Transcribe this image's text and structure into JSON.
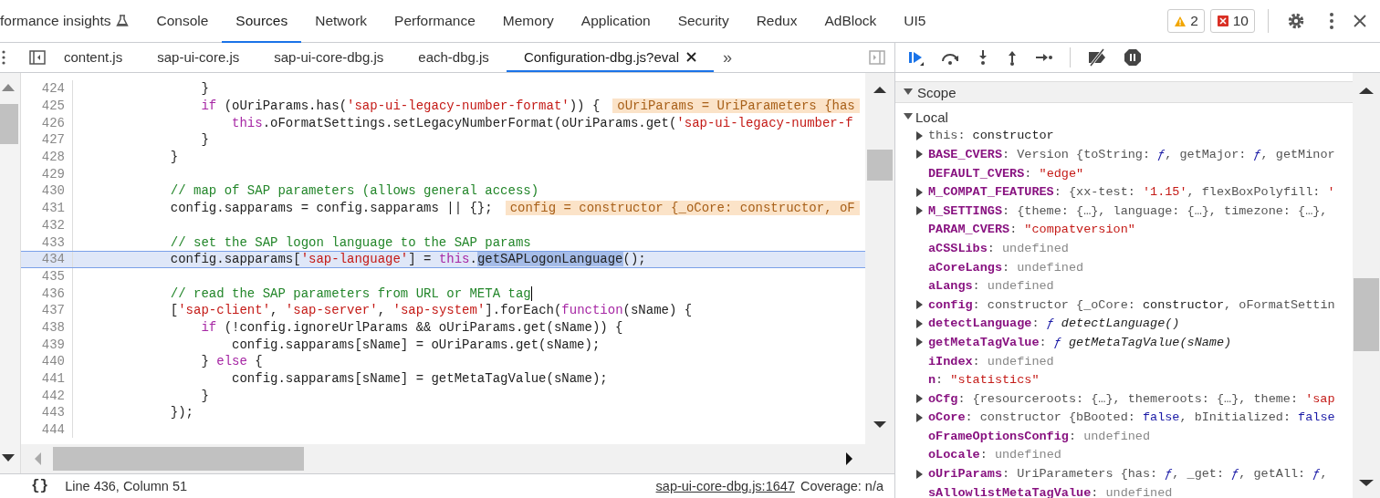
{
  "panel_tabs": [
    {
      "label": "formance insights",
      "kind": "experimental",
      "selected": false
    },
    {
      "label": "Console",
      "kind": "plain",
      "selected": false
    },
    {
      "label": "Sources",
      "kind": "plain",
      "selected": true
    },
    {
      "label": "Network",
      "kind": "plain",
      "selected": false
    },
    {
      "label": "Performance",
      "kind": "plain",
      "selected": false
    },
    {
      "label": "Memory",
      "kind": "plain",
      "selected": false
    },
    {
      "label": "Application",
      "kind": "plain",
      "selected": false
    },
    {
      "label": "Security",
      "kind": "plain",
      "selected": false
    },
    {
      "label": "Redux",
      "kind": "plain",
      "selected": false
    },
    {
      "label": "AdBlock",
      "kind": "plain",
      "selected": false
    },
    {
      "label": "UI5",
      "kind": "plain",
      "selected": false
    }
  ],
  "issue_counters": [
    {
      "kind": "warning",
      "count": "2"
    },
    {
      "kind": "error",
      "count": "10"
    }
  ],
  "file_tabs": [
    {
      "label": "content.js",
      "selected": false
    },
    {
      "label": "sap-ui-core.js",
      "selected": false
    },
    {
      "label": "sap-ui-core-dbg.js",
      "selected": false
    },
    {
      "label": "each-dbg.js",
      "selected": false
    },
    {
      "label": "Configuration-dbg.js?eval",
      "selected": true
    }
  ],
  "more_tabs": "»",
  "editor": {
    "lines": [
      {
        "number": "424",
        "tokens": [
          {
            "kind": "plain",
            "text": "                }"
          }
        ]
      },
      {
        "number": "425",
        "tokens": [
          {
            "kind": "keyword",
            "text": "                if"
          },
          {
            "kind": "plain",
            "text": " (oUriParams.has("
          },
          {
            "kind": "string",
            "text": "'sap-ui-legacy-number-format'"
          },
          {
            "kind": "plain",
            "text": ")) {"
          }
        ],
        "inline_value": "oUriParams = UriParameters {has"
      },
      {
        "number": "426",
        "tokens": [
          {
            "kind": "keyword",
            "text": "                    this"
          },
          {
            "kind": "plain",
            "text": ".oFormatSettings.setLegacyNumberFormat(oUriParams.get("
          },
          {
            "kind": "string",
            "text": "'sap-ui-legacy-number-f"
          }
        ]
      },
      {
        "number": "427",
        "tokens": [
          {
            "kind": "plain",
            "text": "                }"
          }
        ]
      },
      {
        "number": "428",
        "tokens": [
          {
            "kind": "plain",
            "text": "            }"
          }
        ]
      },
      {
        "number": "429"
      },
      {
        "number": "430",
        "tokens": [
          {
            "kind": "comment",
            "text": "            // map of SAP parameters (allows general access)"
          }
        ]
      },
      {
        "number": "431",
        "tokens": [
          {
            "kind": "plain",
            "text": "            config.sapparams = config.sapparams || {};"
          }
        ],
        "inline_value": "config = constructor {_oCore: constructor, oF"
      },
      {
        "number": "432"
      },
      {
        "number": "433",
        "tokens": [
          {
            "kind": "comment",
            "text": "            // set the SAP logon language to the SAP params"
          }
        ]
      },
      {
        "number": "434",
        "highlighted": true,
        "tokens": [
          {
            "kind": "plain",
            "text": "            config.sapparams["
          },
          {
            "kind": "string",
            "text": "'sap-language'"
          },
          {
            "kind": "plain",
            "text": "] = "
          },
          {
            "kind": "keyword",
            "text": "this"
          },
          {
            "kind": "plain",
            "text": "."
          },
          {
            "kind": "selection",
            "text": "getSAPLogonLanguage"
          },
          {
            "kind": "plain",
            "text": "();"
          }
        ]
      },
      {
        "number": "435"
      },
      {
        "number": "436",
        "cursor": true,
        "tokens": [
          {
            "kind": "comment",
            "text": "            // read the SAP parameters from URL or META tag"
          }
        ]
      },
      {
        "number": "437",
        "tokens": [
          {
            "kind": "plain",
            "text": "            ["
          },
          {
            "kind": "string",
            "text": "'sap-client'"
          },
          {
            "kind": "plain",
            "text": ", "
          },
          {
            "kind": "string",
            "text": "'sap-server'"
          },
          {
            "kind": "plain",
            "text": ", "
          },
          {
            "kind": "string",
            "text": "'sap-system'"
          },
          {
            "kind": "plain",
            "text": "].forEach("
          },
          {
            "kind": "keyword",
            "text": "function"
          },
          {
            "kind": "plain",
            "text": "(sName) {"
          }
        ]
      },
      {
        "number": "438",
        "tokens": [
          {
            "kind": "keyword",
            "text": "                if"
          },
          {
            "kind": "plain",
            "text": " (!config.ignoreUrlParams && oUriParams.get(sName)) {"
          }
        ]
      },
      {
        "number": "439",
        "tokens": [
          {
            "kind": "plain",
            "text": "                    config.sapparams[sName] = oUriParams.get(sName);"
          }
        ]
      },
      {
        "number": "440",
        "tokens": [
          {
            "kind": "plain",
            "text": "                } "
          },
          {
            "kind": "keyword",
            "text": "else"
          },
          {
            "kind": "plain",
            "text": " {"
          }
        ]
      },
      {
        "number": "441",
        "tokens": [
          {
            "kind": "plain",
            "text": "                    config.sapparams[sName] = getMetaTagValue(sName);"
          }
        ]
      },
      {
        "number": "442",
        "tokens": [
          {
            "kind": "plain",
            "text": "                }"
          }
        ]
      },
      {
        "number": "443",
        "tokens": [
          {
            "kind": "plain",
            "text": "            });"
          }
        ]
      },
      {
        "number": "444"
      }
    ]
  },
  "status_bar": {
    "pretty_print": "{}",
    "position": "Line 436, Column 51",
    "source_link": "sap-ui-core-dbg.js:1647",
    "coverage": "Coverage: n/a"
  },
  "scope": {
    "title": "Scope",
    "expanded": true,
    "sections": [
      {
        "title": "Local",
        "expanded": true,
        "entries": [
          {
            "name": "this",
            "kind": "receiver",
            "expandable": true,
            "value": [
              {
                "kind": "dim",
                "text": ": "
              },
              {
                "kind": "plain",
                "text": "constructor"
              }
            ]
          },
          {
            "name": "BASE_CVERS",
            "kind": "property",
            "expandable": true,
            "value": [
              {
                "kind": "dim",
                "text": ": Version {toString: "
              },
              {
                "kind": "function",
                "text": "ƒ"
              },
              {
                "kind": "dim",
                "text": ", getMajor: "
              },
              {
                "kind": "function",
                "text": "ƒ"
              },
              {
                "kind": "dim",
                "text": ", getMinor"
              }
            ]
          },
          {
            "name": "DEFAULT_CVERS",
            "kind": "property",
            "expandable": false,
            "value": [
              {
                "kind": "dim",
                "text": ": "
              },
              {
                "kind": "string",
                "text": "\"edge\""
              }
            ]
          },
          {
            "name": "M_COMPAT_FEATURES",
            "kind": "property",
            "expandable": true,
            "value": [
              {
                "kind": "dim",
                "text": ": {xx-test: "
              },
              {
                "kind": "string",
                "text": "'1.15'"
              },
              {
                "kind": "dim",
                "text": ", flexBoxPolyfill: "
              },
              {
                "kind": "string",
                "text": "'"
              }
            ]
          },
          {
            "name": "M_SETTINGS",
            "kind": "property",
            "expandable": true,
            "value": [
              {
                "kind": "dim",
                "text": ": {theme: {…}, language: {…}, timezone: {…},"
              }
            ]
          },
          {
            "name": "PARAM_CVERS",
            "kind": "property",
            "expandable": false,
            "value": [
              {
                "kind": "dim",
                "text": ": "
              },
              {
                "kind": "string",
                "text": "\"compatversion\""
              }
            ]
          },
          {
            "name": "aCSSLibs",
            "kind": "property",
            "expandable": false,
            "value": [
              {
                "kind": "dim",
                "text": ": "
              },
              {
                "kind": "undefined",
                "text": "undefined"
              }
            ]
          },
          {
            "name": "aCoreLangs",
            "kind": "property",
            "expandable": false,
            "value": [
              {
                "kind": "dim",
                "text": ": "
              },
              {
                "kind": "undefined",
                "text": "undefined"
              }
            ]
          },
          {
            "name": "aLangs",
            "kind": "property",
            "expandable": false,
            "value": [
              {
                "kind": "dim",
                "text": ": "
              },
              {
                "kind": "undefined",
                "text": "undefined"
              }
            ]
          },
          {
            "name": "config",
            "kind": "property",
            "expandable": true,
            "value": [
              {
                "kind": "dim",
                "text": ": constructor {_oCore: "
              },
              {
                "kind": "plain",
                "text": "constructor"
              },
              {
                "kind": "dim",
                "text": ", oFormatSettin"
              }
            ]
          },
          {
            "name": "detectLanguage",
            "kind": "property",
            "expandable": true,
            "value": [
              {
                "kind": "dim",
                "text": ": "
              },
              {
                "kind": "function",
                "text": "ƒ"
              },
              {
                "kind": "italic",
                "text": " detectLanguage()"
              }
            ]
          },
          {
            "name": "getMetaTagValue",
            "kind": "property",
            "expandable": true,
            "value": [
              {
                "kind": "dim",
                "text": ": "
              },
              {
                "kind": "function",
                "text": "ƒ"
              },
              {
                "kind": "italic",
                "text": " getMetaTagValue(sName)"
              }
            ]
          },
          {
            "name": "iIndex",
            "kind": "property",
            "expandable": false,
            "value": [
              {
                "kind": "dim",
                "text": ": "
              },
              {
                "kind": "undefined",
                "text": "undefined"
              }
            ]
          },
          {
            "name": "n",
            "kind": "property",
            "expandable": false,
            "value": [
              {
                "kind": "dim",
                "text": ": "
              },
              {
                "kind": "string",
                "text": "\"statistics\""
              }
            ]
          },
          {
            "name": "oCfg",
            "kind": "property",
            "expandable": true,
            "value": [
              {
                "kind": "dim",
                "text": ": {resourceroots: {…}, themeroots: {…}, theme: "
              },
              {
                "kind": "string",
                "text": "'sap"
              }
            ]
          },
          {
            "name": "oCore",
            "kind": "property",
            "expandable": true,
            "value": [
              {
                "kind": "dim",
                "text": ": constructor {bBooted: "
              },
              {
                "kind": "boolean",
                "text": "false"
              },
              {
                "kind": "dim",
                "text": ", bInitialized: "
              },
              {
                "kind": "boolean",
                "text": "false"
              }
            ]
          },
          {
            "name": "oFrameOptionsConfig",
            "kind": "property",
            "expandable": false,
            "value": [
              {
                "kind": "dim",
                "text": ": "
              },
              {
                "kind": "undefined",
                "text": "undefined"
              }
            ]
          },
          {
            "name": "oLocale",
            "kind": "property",
            "expandable": false,
            "value": [
              {
                "kind": "dim",
                "text": ": "
              },
              {
                "kind": "undefined",
                "text": "undefined"
              }
            ]
          },
          {
            "name": "oUriParams",
            "kind": "property",
            "expandable": true,
            "value": [
              {
                "kind": "dim",
                "text": ": UriParameters {has: "
              },
              {
                "kind": "function",
                "text": "ƒ"
              },
              {
                "kind": "dim",
                "text": ", _get: "
              },
              {
                "kind": "function",
                "text": "ƒ"
              },
              {
                "kind": "dim",
                "text": ", getAll: "
              },
              {
                "kind": "function",
                "text": "ƒ"
              },
              {
                "kind": "dim",
                "text": ","
              }
            ]
          },
          {
            "name": "sAllowlistMetaTagValue",
            "kind": "property",
            "expandable": false,
            "value": [
              {
                "kind": "dim",
                "text": ": "
              },
              {
                "kind": "undefined",
                "text": "undefined"
              }
            ]
          }
        ]
      }
    ]
  }
}
